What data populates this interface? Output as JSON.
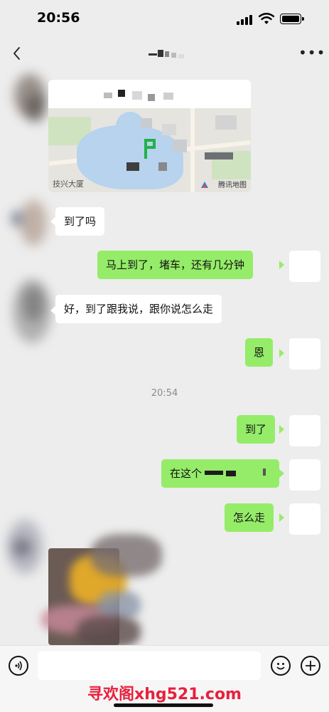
{
  "status_bar": {
    "time": "20:56"
  },
  "header": {
    "back_icon": "chevron-left-icon",
    "more_icon": "more-dots-icon",
    "more_label": "•••"
  },
  "location": {
    "map_label": "技兴大厦",
    "map_brand": "腾讯地图"
  },
  "messages": [
    {
      "side": "left",
      "text": "到了吗"
    },
    {
      "side": "right",
      "text": "马上到了，堵车，还有几分钟"
    },
    {
      "side": "left",
      "text": "好，到了跟我说，跟你说怎么走"
    },
    {
      "side": "right",
      "text": "恩"
    },
    {
      "side": "right",
      "text": "到了"
    },
    {
      "side": "right",
      "text": "在这个"
    },
    {
      "side": "right",
      "text": "怎么走"
    }
  ],
  "timestamp": "20:54",
  "input_bar": {
    "voice_icon": "voice-icon",
    "emoji_icon": "emoji-icon",
    "plus_icon": "plus-icon"
  },
  "watermark": "寻欢阁xhg521.com",
  "colors": {
    "bubble_green": "#95ec69",
    "background": "#ededed",
    "watermark_red": "#e8203c"
  }
}
